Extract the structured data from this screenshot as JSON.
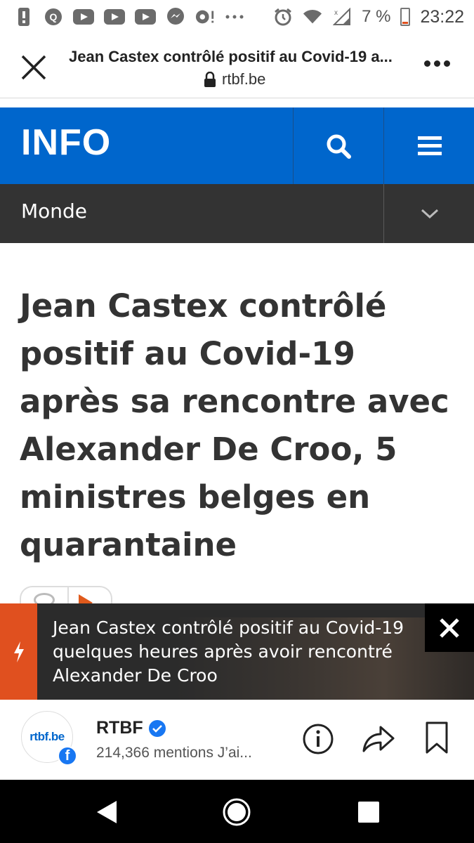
{
  "status_bar": {
    "battery": "7 %",
    "time": "23:22"
  },
  "browser": {
    "title": "Jean Castex contrôlé positif au Covid-19 a...",
    "url": "rtbf.be"
  },
  "site": {
    "logo": "INFO",
    "section": "Monde",
    "accent_color": "#0066cc"
  },
  "article": {
    "headline": "Jean Castex contrôlé positif au Covid-19 après sa rencontre avec Alexander De Croo, 5 ministres belges en quarantaine"
  },
  "banner": {
    "text": "Jean Castex contrôlé positif au Covid-19 quelques heures après avoir rencontré Alexander De Croo",
    "accent_color": "#e0501f"
  },
  "facebook": {
    "page_name": "RTBF",
    "likes": "214,366 mentions J’ai...",
    "avatar_logo": "rtbf.be"
  }
}
